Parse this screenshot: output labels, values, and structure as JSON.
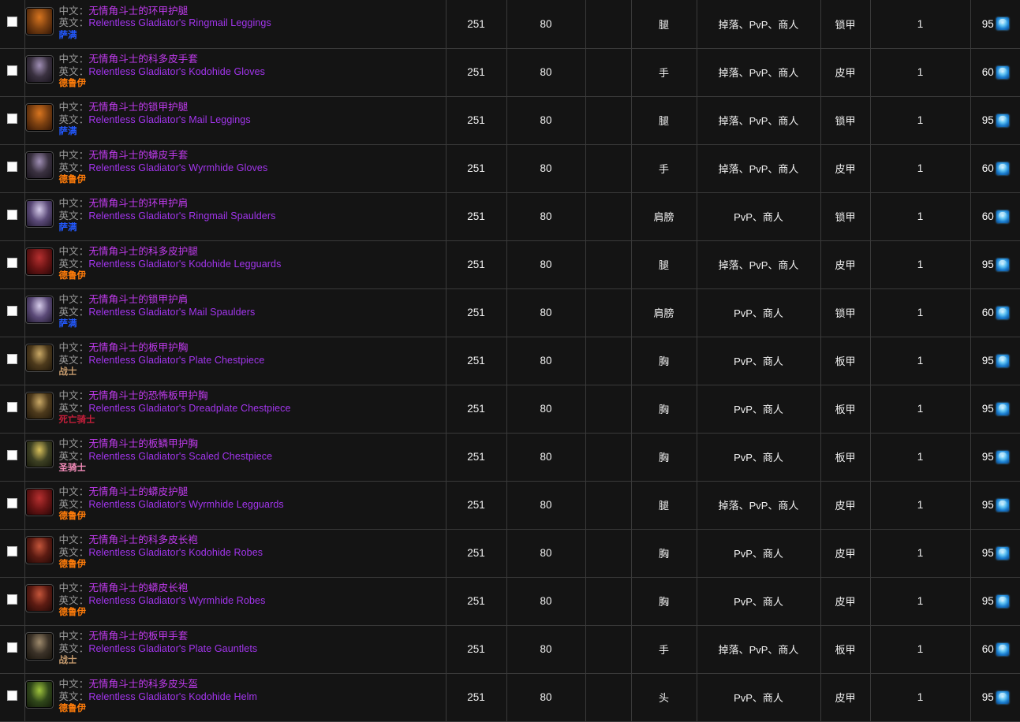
{
  "table": {
    "labels": {
      "cn_prefix": "中文：",
      "en_prefix": "英文："
    },
    "class_colors": {
      "萨满": "#2359ff",
      "德鲁伊": "#ff7c0a",
      "战士": "#c69b6d",
      "死亡骑士": "#c41e3a",
      "圣骑士": "#f48cba"
    },
    "icons": {
      "cost_currency": "arena-points-icon",
      "checkbox": "checkbox-icon"
    },
    "rows": [
      {
        "checked": false,
        "icon": "ringmail-leggings-icon",
        "icon_colors": [
          "#7a3f10",
          "#d8751f",
          "#2a1206"
        ],
        "name_cn": "无情角斗士的环甲护腿",
        "name_en": "Relentless Gladiator's Ringmail Leggings",
        "class": "萨满",
        "ilvl": "251",
        "req_level": "80",
        "blank": "",
        "slot": "腿",
        "source": "掉落、PvP、商人",
        "armor": "锁甲",
        "count": "1",
        "cost": "95"
      },
      {
        "checked": false,
        "icon": "kodohide-gloves-icon",
        "icon_colors": [
          "#3a3140",
          "#a08fb5",
          "#141018"
        ],
        "name_cn": "无情角斗士的科多皮手套",
        "name_en": "Relentless Gladiator's Kodohide Gloves",
        "class": "德鲁伊",
        "ilvl": "251",
        "req_level": "80",
        "blank": "",
        "slot": "手",
        "source": "掉落、PvP、商人",
        "armor": "皮甲",
        "count": "1",
        "cost": "60"
      },
      {
        "checked": false,
        "icon": "mail-leggings-icon",
        "icon_colors": [
          "#7a3f10",
          "#d8751f",
          "#2a1206"
        ],
        "name_cn": "无情角斗士的锁甲护腿",
        "name_en": "Relentless Gladiator's Mail Leggings",
        "class": "萨满",
        "ilvl": "251",
        "req_level": "80",
        "blank": "",
        "slot": "腿",
        "source": "掉落、PvP、商人",
        "armor": "锁甲",
        "count": "1",
        "cost": "95"
      },
      {
        "checked": false,
        "icon": "wyrmhide-gloves-icon",
        "icon_colors": [
          "#3a3140",
          "#a08fb5",
          "#141018"
        ],
        "name_cn": "无情角斗士的蟒皮手套",
        "name_en": "Relentless Gladiator's Wyrmhide Gloves",
        "class": "德鲁伊",
        "ilvl": "251",
        "req_level": "80",
        "blank": "",
        "slot": "手",
        "source": "掉落、PvP、商人",
        "armor": "皮甲",
        "count": "1",
        "cost": "60"
      },
      {
        "checked": false,
        "icon": "ringmail-spaulders-icon",
        "icon_colors": [
          "#5b4a78",
          "#d6ccea",
          "#1a1426"
        ],
        "name_cn": "无情角斗士的环甲护肩",
        "name_en": "Relentless Gladiator's Ringmail Spaulders",
        "class": "萨满",
        "ilvl": "251",
        "req_level": "80",
        "blank": "",
        "slot": "肩膀",
        "source": "PvP、商人",
        "armor": "锁甲",
        "count": "1",
        "cost": "60"
      },
      {
        "checked": false,
        "icon": "kodohide-legguards-icon",
        "icon_colors": [
          "#6b1414",
          "#b63030",
          "#200606"
        ],
        "name_cn": "无情角斗士的科多皮护腿",
        "name_en": "Relentless Gladiator's Kodohide Legguards",
        "class": "德鲁伊",
        "ilvl": "251",
        "req_level": "80",
        "blank": "",
        "slot": "腿",
        "source": "掉落、PvP、商人",
        "armor": "皮甲",
        "count": "1",
        "cost": "95"
      },
      {
        "checked": false,
        "icon": "mail-spaulders-icon",
        "icon_colors": [
          "#5b4a78",
          "#d6ccea",
          "#1a1426"
        ],
        "name_cn": "无情角斗士的锁甲护肩",
        "name_en": "Relentless Gladiator's Mail Spaulders",
        "class": "萨满",
        "ilvl": "251",
        "req_level": "80",
        "blank": "",
        "slot": "肩膀",
        "source": "PvP、商人",
        "armor": "锁甲",
        "count": "1",
        "cost": "60"
      },
      {
        "checked": false,
        "icon": "plate-chestpiece-icon",
        "icon_colors": [
          "#4d3a1c",
          "#c9a865",
          "#1c1409"
        ],
        "name_cn": "无情角斗士的板甲护胸",
        "name_en": "Relentless Gladiator's Plate Chestpiece",
        "class": "战士",
        "ilvl": "251",
        "req_level": "80",
        "blank": "",
        "slot": "胸",
        "source": "PvP、商人",
        "armor": "板甲",
        "count": "1",
        "cost": "95"
      },
      {
        "checked": false,
        "icon": "dreadplate-chestpiece-icon",
        "icon_colors": [
          "#4d3a1c",
          "#c9a865",
          "#1c1409"
        ],
        "name_cn": "无情角斗士的恐怖板甲护胸",
        "name_en": "Relentless Gladiator's Dreadplate Chestpiece",
        "class": "死亡骑士",
        "ilvl": "251",
        "req_level": "80",
        "blank": "",
        "slot": "胸",
        "source": "PvP、商人",
        "armor": "板甲",
        "count": "1",
        "cost": "95"
      },
      {
        "checked": false,
        "icon": "scaled-chestpiece-icon",
        "icon_colors": [
          "#3d4023",
          "#d8c05a",
          "#14160a"
        ],
        "name_cn": "无情角斗士的板鳞甲护胸",
        "name_en": "Relentless Gladiator's Scaled Chestpiece",
        "class": "圣骑士",
        "ilvl": "251",
        "req_level": "80",
        "blank": "",
        "slot": "胸",
        "source": "PvP、商人",
        "armor": "板甲",
        "count": "1",
        "cost": "95"
      },
      {
        "checked": false,
        "icon": "wyrmhide-legguards-icon",
        "icon_colors": [
          "#6b1414",
          "#b63030",
          "#200606"
        ],
        "name_cn": "无情角斗士的蟒皮护腿",
        "name_en": "Relentless Gladiator's Wyrmhide Legguards",
        "class": "德鲁伊",
        "ilvl": "251",
        "req_level": "80",
        "blank": "",
        "slot": "腿",
        "source": "掉落、PvP、商人",
        "armor": "皮甲",
        "count": "1",
        "cost": "95"
      },
      {
        "checked": false,
        "icon": "kodohide-robes-icon",
        "icon_colors": [
          "#5c1b12",
          "#c4553a",
          "#1c0806"
        ],
        "name_cn": "无情角斗士的科多皮长袍",
        "name_en": "Relentless Gladiator's Kodohide Robes",
        "class": "德鲁伊",
        "ilvl": "251",
        "req_level": "80",
        "blank": "",
        "slot": "胸",
        "source": "PvP、商人",
        "armor": "皮甲",
        "count": "1",
        "cost": "95"
      },
      {
        "checked": false,
        "icon": "wyrmhide-robes-icon",
        "icon_colors": [
          "#5c1b12",
          "#c4553a",
          "#1c0806"
        ],
        "name_cn": "无情角斗士的蟒皮长袍",
        "name_en": "Relentless Gladiator's Wyrmhide Robes",
        "class": "德鲁伊",
        "ilvl": "251",
        "req_level": "80",
        "blank": "",
        "slot": "胸",
        "source": "PvP、商人",
        "armor": "皮甲",
        "count": "1",
        "cost": "95"
      },
      {
        "checked": false,
        "icon": "plate-gauntlets-icon",
        "icon_colors": [
          "#3b3228",
          "#9e8a6c",
          "#141009"
        ],
        "name_cn": "无情角斗士的板甲手套",
        "name_en": "Relentless Gladiator's Plate Gauntlets",
        "class": "战士",
        "ilvl": "251",
        "req_level": "80",
        "blank": "",
        "slot": "手",
        "source": "掉落、PvP、商人",
        "armor": "板甲",
        "count": "1",
        "cost": "60"
      },
      {
        "checked": false,
        "icon": "kodohide-helm-icon",
        "icon_colors": [
          "#30471a",
          "#9fc43c",
          "#0f1608"
        ],
        "name_cn": "无情角斗士的科多皮头盔",
        "name_en": "Relentless Gladiator's Kodohide Helm",
        "class": "德鲁伊",
        "ilvl": "251",
        "req_level": "80",
        "blank": "",
        "slot": "头",
        "source": "PvP、商人",
        "armor": "皮甲",
        "count": "1",
        "cost": "95"
      }
    ]
  }
}
